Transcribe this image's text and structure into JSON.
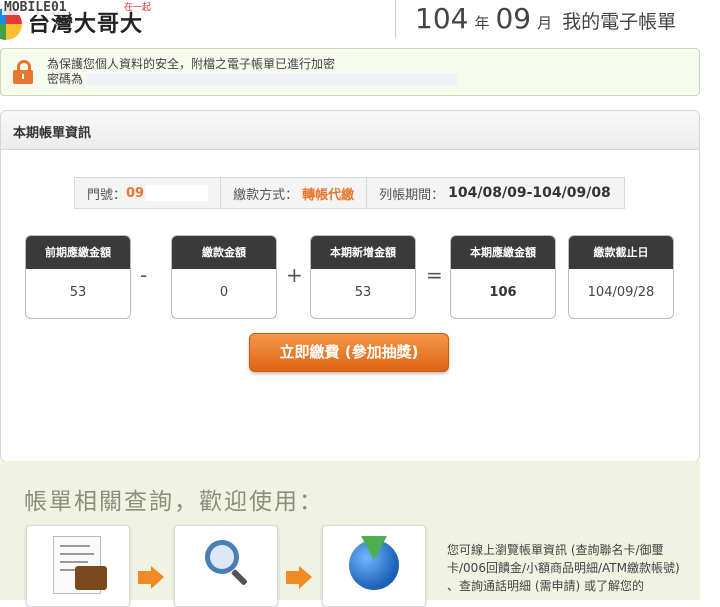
{
  "header": {
    "logo_text": "台灣大哥大",
    "watermark": "MOBILE01",
    "slogan": "在一起",
    "year": "104",
    "year_unit": "年",
    "month": "09",
    "month_unit": "月",
    "title": "我的電子帳單"
  },
  "notice": {
    "line1": "為保護您個人資料的安全，附檔之電子帳單已進行加密",
    "line2_label": "密碼為"
  },
  "bill": {
    "section_title": "本期帳單資訊",
    "phone_label": "門號：",
    "phone_value": "09",
    "payment_label": "繳款方式：",
    "payment_value": "轉帳代繳",
    "period_label": "列帳期間：",
    "period_value": "104/08/09-104/09/08",
    "boxes": [
      {
        "label": "前期應繳金額",
        "value": "53"
      },
      {
        "label": "繳款金額",
        "value": "0"
      },
      {
        "label": "本期新增金額",
        "value": "53"
      },
      {
        "label": "本期應繳金額",
        "value": "106"
      },
      {
        "label": "繳款截止日",
        "value": "104/09/28"
      }
    ],
    "operators": [
      "-",
      "+",
      "="
    ],
    "pay_button": "立即繳費 (參加抽獎)"
  },
  "inquiry": {
    "title": "帳單相關查詢，歡迎使用：",
    "description": "您可線上瀏覽帳單資訊 (查詢聯名卡/御璽卡/006回饋金/小額商品明細/ATM繳款帳號) 、查詢通話明細 (需申請) 或了解您的"
  },
  "colors": {
    "accent_orange": "#e8762c",
    "box_header": "#3a3a3a",
    "inquiry_bg": "#f0f3e1"
  }
}
